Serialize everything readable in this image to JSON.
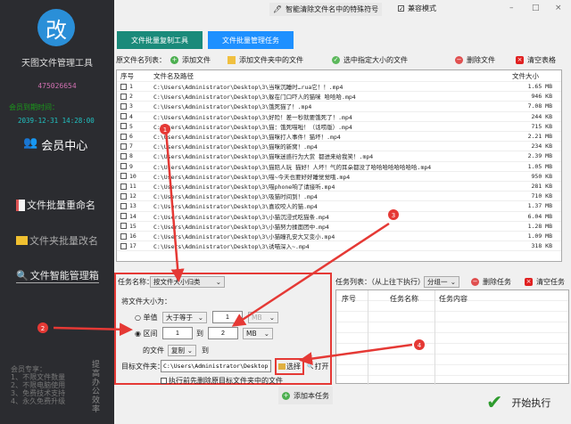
{
  "sidebar": {
    "logo_text": "改",
    "app_name": "天图文件管理工具",
    "user_id": "475026654",
    "expire_label": "会员到期时间：",
    "expire_time": "2039-12-31 14:28:00",
    "member_center": "会员中心",
    "items": [
      {
        "label": "文件批量重命名"
      },
      {
        "label": "文件夹批量改名"
      },
      {
        "label": "文件智能管理箱"
      }
    ],
    "perks": [
      "会员专享：",
      "1、不限文件数量",
      "2、不限电脑使用",
      "3、免费技术支持",
      "4、永久免费升级"
    ],
    "slogan": "提高办公效率"
  },
  "titlebar": {
    "special_chars": "智能清除文件名中的特殊符号",
    "compat_mode": "兼容模式",
    "compat_checked": true
  },
  "tabs": [
    {
      "label": "文件批量复制工具",
      "color": "#1a8a7a"
    },
    {
      "label": "文件批量管理任务",
      "color": "#1e90ff"
    }
  ],
  "toolbar": {
    "list_label": "原文件名列表：",
    "add_file": "添加文件",
    "add_folder": "添加文件夹中的文件",
    "select_size": "选中指定大小的文件",
    "delete_file": "删除文件",
    "clear_table": "清空表格"
  },
  "table": {
    "headers": [
      "序号",
      "文件名及路径",
      "文件大小"
    ],
    "rows": [
      [
        "1",
        "C:\\Users\\Administrator\\Desktop\\3\\当咪沉睡时…rua它！！.mp4",
        "1.65 MB"
      ],
      [
        "2",
        "C:\\Users\\Administrator\\Desktop\\3\\躲在门口吓人的猫咪 哈哈哈.mp4",
        "946 KB"
      ],
      [
        "3",
        "C:\\Users\\Administrator\\Desktop\\3\\饿死猫了！.mp4",
        "7.08 MB"
      ],
      [
        "4",
        "C:\\Users\\Administrator\\Desktop\\3\\好险！差一秒就要饿死了！.mp4",
        "244 KB"
      ],
      [
        "5",
        "C:\\Users\\Administrator\\Desktop\\3\\猫：饿死喵啦！（话唠版）.mp4",
        "715 KB"
      ],
      [
        "6",
        "C:\\Users\\Administrator\\Desktop\\3\\猫咪打人事件！猫坏！.mp4",
        "2.21 MB"
      ],
      [
        "7",
        "C:\\Users\\Administrator\\Desktop\\3\\猫咪的新窝！.mp4",
        "234 KB"
      ],
      [
        "8",
        "C:\\Users\\Administrator\\Desktop\\3\\猫咪迷惑行为大赏 都进来给我笑！.mp4",
        "2.39 MB"
      ],
      [
        "9",
        "C:\\Users\\Administrator\\Desktop\\3\\猫陪人玩 猫好！人坏！气的耳朵都没了哈哈哈哈哈哈哈哈.mp4",
        "1.05 MB"
      ],
      [
        "10",
        "C:\\Users\\Administrator\\Desktop\\3\\喵~今天也要好好睡觉觉哦.mp4",
        "950 KB"
      ],
      [
        "11",
        "C:\\Users\\Administrator\\Desktop\\3\\喵phone响了请接听.mp4",
        "281 KB"
      ],
      [
        "12",
        "C:\\Users\\Administrator\\Desktop\\3\\吸猫时间到！.mp4",
        "710 KB"
      ],
      [
        "13",
        "C:\\Users\\Administrator\\Desktop\\3\\喜欢咬人的猫.mp4",
        "1.37 MB"
      ],
      [
        "14",
        "C:\\Users\\Administrator\\Desktop\\3\\小猫沉浸式吃猫条.mp4",
        "6.04 MB"
      ],
      [
        "15",
        "C:\\Users\\Administrator\\Desktop\\3\\小猫努力揉面团中.mp4",
        "1.28 MB"
      ],
      [
        "16",
        "C:\\Users\\Administrator\\Desktop\\3\\小猫瞳孔安大又变小.mp4",
        "1.09 MB"
      ],
      [
        "17",
        "C:\\Users\\Administrator\\Desktop\\3\\诱喵深入~.mp4",
        "318 KB"
      ]
    ]
  },
  "task_form": {
    "task_name_label": "任务名称：",
    "task_name": "按文件大小归类",
    "size_label": "将文件大小为：",
    "single": "单值",
    "single_op": "大于等于",
    "single_val": "1",
    "single_unit": "MB",
    "range": "区间",
    "range_from": "1",
    "to": "到",
    "range_to": "2",
    "range_unit": "MB",
    "files_of": "的文件",
    "action": "复制",
    "action_to": "到",
    "target_label": "目标文件夹：",
    "target_path": "C:\\Users\\Administrator\\Desktop\\4",
    "choose": "选择",
    "open": "打开",
    "delete_before": "执行前先删除原目标文件夹中的文件",
    "add_task": "添加本任务",
    "selected_mode": "range"
  },
  "task_list": {
    "label": "任务列表：（从上往下执行）",
    "group": "分组一",
    "delete_task": "删除任务",
    "clear_tasks": "清空任务",
    "headers": [
      "序号",
      "任务名称",
      "任务内容"
    ],
    "start": "开始执行"
  },
  "annotations": [
    "1",
    "2",
    "3",
    "4"
  ]
}
